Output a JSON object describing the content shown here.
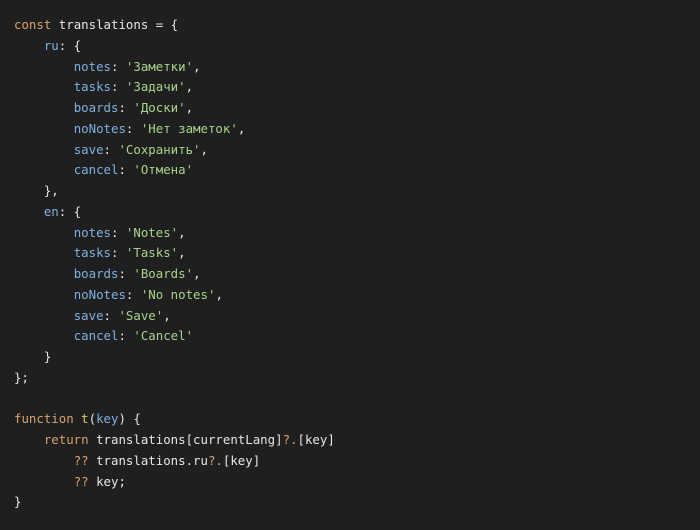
{
  "editor": {
    "background": "#1f1f1f",
    "colors": {
      "keyword": "#d7a36b",
      "property": "#7fb0e0",
      "string": "#a8d48a",
      "function": "#e3c76f",
      "text": "#e6e6e6"
    },
    "lines": [
      [
        {
          "t": "const",
          "c": "keyword"
        },
        {
          "t": " translations = {",
          "c": "default"
        }
      ],
      [
        {
          "t": "    ",
          "c": "default"
        },
        {
          "t": "ru",
          "c": "prop"
        },
        {
          "t": ": {",
          "c": "default"
        }
      ],
      [
        {
          "t": "        ",
          "c": "default"
        },
        {
          "t": "notes",
          "c": "prop"
        },
        {
          "t": ": ",
          "c": "default"
        },
        {
          "t": "'Заметки'",
          "c": "string"
        },
        {
          "t": ",",
          "c": "default"
        }
      ],
      [
        {
          "t": "        ",
          "c": "default"
        },
        {
          "t": "tasks",
          "c": "prop"
        },
        {
          "t": ": ",
          "c": "default"
        },
        {
          "t": "'Задачи'",
          "c": "string"
        },
        {
          "t": ",",
          "c": "default"
        }
      ],
      [
        {
          "t": "        ",
          "c": "default"
        },
        {
          "t": "boards",
          "c": "prop"
        },
        {
          "t": ": ",
          "c": "default"
        },
        {
          "t": "'Доски'",
          "c": "string"
        },
        {
          "t": ",",
          "c": "default"
        }
      ],
      [
        {
          "t": "        ",
          "c": "default"
        },
        {
          "t": "noNotes",
          "c": "prop"
        },
        {
          "t": ": ",
          "c": "default"
        },
        {
          "t": "'Нет заметок'",
          "c": "string"
        },
        {
          "t": ",",
          "c": "default"
        }
      ],
      [
        {
          "t": "        ",
          "c": "default"
        },
        {
          "t": "save",
          "c": "prop"
        },
        {
          "t": ": ",
          "c": "default"
        },
        {
          "t": "'Сохранить'",
          "c": "string"
        },
        {
          "t": ",",
          "c": "default"
        }
      ],
      [
        {
          "t": "        ",
          "c": "default"
        },
        {
          "t": "cancel",
          "c": "prop"
        },
        {
          "t": ": ",
          "c": "default"
        },
        {
          "t": "'Отмена'",
          "c": "string"
        }
      ],
      [
        {
          "t": "    },",
          "c": "default"
        }
      ],
      [
        {
          "t": "    ",
          "c": "default"
        },
        {
          "t": "en",
          "c": "prop"
        },
        {
          "t": ": {",
          "c": "default"
        }
      ],
      [
        {
          "t": "        ",
          "c": "default"
        },
        {
          "t": "notes",
          "c": "prop"
        },
        {
          "t": ": ",
          "c": "default"
        },
        {
          "t": "'Notes'",
          "c": "string"
        },
        {
          "t": ",",
          "c": "default"
        }
      ],
      [
        {
          "t": "        ",
          "c": "default"
        },
        {
          "t": "tasks",
          "c": "prop"
        },
        {
          "t": ": ",
          "c": "default"
        },
        {
          "t": "'Tasks'",
          "c": "string"
        },
        {
          "t": ",",
          "c": "default"
        }
      ],
      [
        {
          "t": "        ",
          "c": "default"
        },
        {
          "t": "boards",
          "c": "prop"
        },
        {
          "t": ": ",
          "c": "default"
        },
        {
          "t": "'Boards'",
          "c": "string"
        },
        {
          "t": ",",
          "c": "default"
        }
      ],
      [
        {
          "t": "        ",
          "c": "default"
        },
        {
          "t": "noNotes",
          "c": "prop"
        },
        {
          "t": ": ",
          "c": "default"
        },
        {
          "t": "'No notes'",
          "c": "string"
        },
        {
          "t": ",",
          "c": "default"
        }
      ],
      [
        {
          "t": "        ",
          "c": "default"
        },
        {
          "t": "save",
          "c": "prop"
        },
        {
          "t": ": ",
          "c": "default"
        },
        {
          "t": "'Save'",
          "c": "string"
        },
        {
          "t": ",",
          "c": "default"
        }
      ],
      [
        {
          "t": "        ",
          "c": "default"
        },
        {
          "t": "cancel",
          "c": "prop"
        },
        {
          "t": ": ",
          "c": "default"
        },
        {
          "t": "'Cancel'",
          "c": "string"
        }
      ],
      [
        {
          "t": "    }",
          "c": "default"
        }
      ],
      [
        {
          "t": "};",
          "c": "default"
        }
      ],
      [],
      [
        {
          "t": "function",
          "c": "keyword"
        },
        {
          "t": " ",
          "c": "default"
        },
        {
          "t": "t",
          "c": "func"
        },
        {
          "t": "(",
          "c": "default"
        },
        {
          "t": "key",
          "c": "param"
        },
        {
          "t": ") {",
          "c": "default"
        }
      ],
      [
        {
          "t": "    ",
          "c": "default"
        },
        {
          "t": "return",
          "c": "keyword"
        },
        {
          "t": " translations[currentLang]",
          "c": "default"
        },
        {
          "t": "?.",
          "c": "op"
        },
        {
          "t": "[key]",
          "c": "default"
        }
      ],
      [
        {
          "t": "        ",
          "c": "default"
        },
        {
          "t": "??",
          "c": "op"
        },
        {
          "t": " translations.ru",
          "c": "default"
        },
        {
          "t": "?.",
          "c": "op"
        },
        {
          "t": "[key]",
          "c": "default"
        }
      ],
      [
        {
          "t": "        ",
          "c": "default"
        },
        {
          "t": "??",
          "c": "op"
        },
        {
          "t": " key;",
          "c": "default"
        }
      ],
      [
        {
          "t": "}",
          "c": "default"
        }
      ]
    ]
  }
}
